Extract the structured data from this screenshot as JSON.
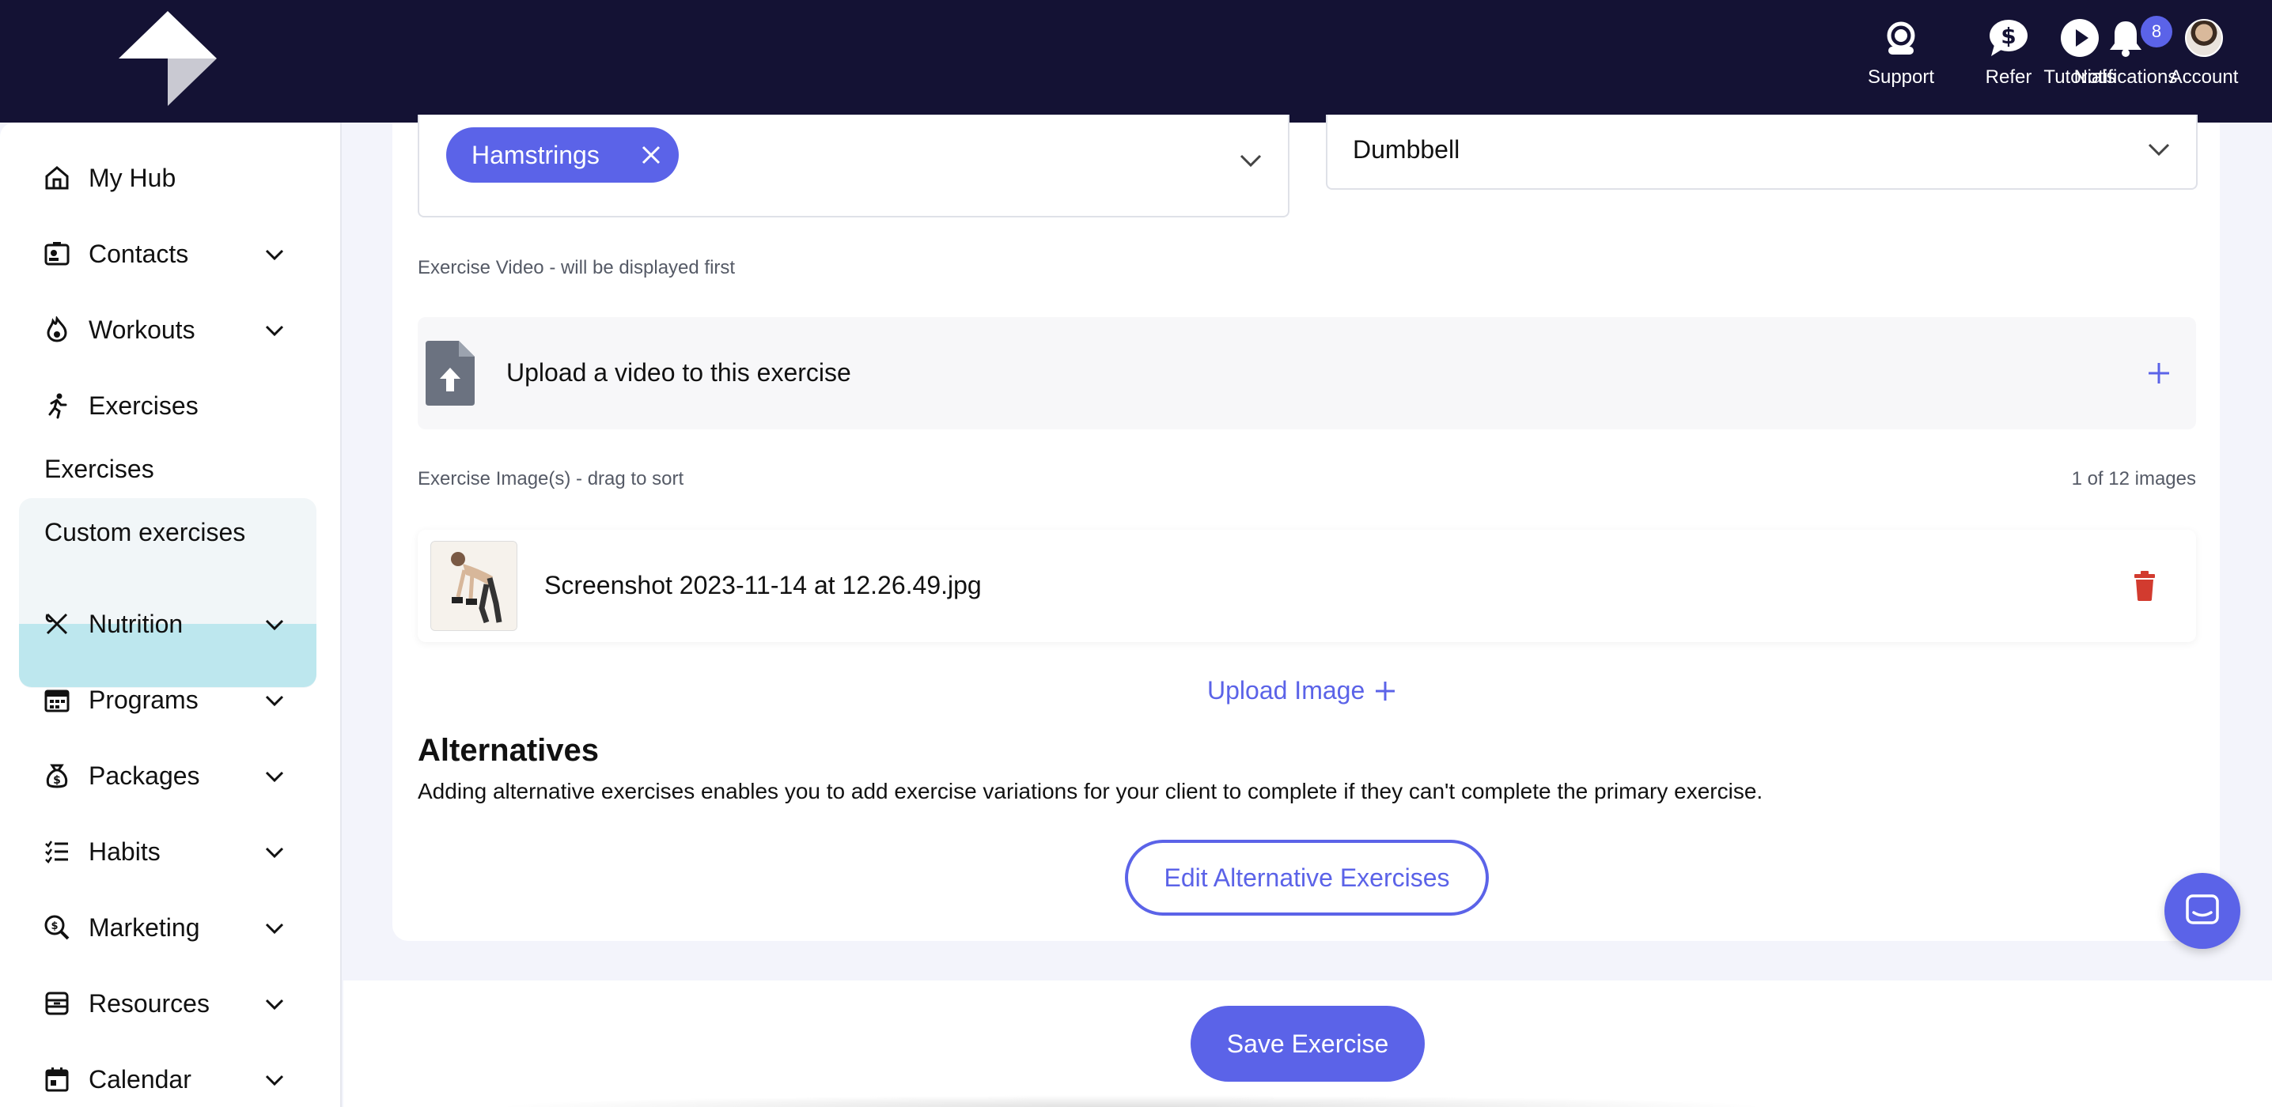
{
  "topnav": {
    "support": "Support",
    "refer": "Refer",
    "tutorials": "Tutorials",
    "notifications": "Notifications",
    "notifications_count": "8",
    "account": "Account"
  },
  "sidebar": {
    "my_hub": "My Hub",
    "contacts": "Contacts",
    "workouts": "Workouts",
    "exercises": "Exercises",
    "exercises_sub": "Exercises",
    "custom_exercises": "Custom exercises",
    "nutrition": "Nutrition",
    "programs": "Programs",
    "packages": "Packages",
    "habits": "Habits",
    "marketing": "Marketing",
    "resources": "Resources",
    "calendar": "Calendar"
  },
  "form": {
    "muscle_chip": "Hamstrings",
    "equipment_value": "Dumbbell",
    "video_label": "Exercise Video - will be displayed first",
    "upload_video_text": "Upload a video to this exercise",
    "images_label": "Exercise Image(s) - drag to sort",
    "images_count": "1 of 12 images",
    "image_filename": "Screenshot 2023-11-14 at 12.26.49.jpg",
    "upload_image": "Upload Image",
    "alternatives_title": "Alternatives",
    "alternatives_desc": "Adding alternative exercises enables you to add exercise variations for your client to complete if they can't complete the primary exercise.",
    "edit_alternatives": "Edit Alternative Exercises",
    "save_exercise": "Save Exercise"
  },
  "colors": {
    "topbar": "#141234",
    "accent": "#5b63e8",
    "active_nav": "#bde7ee",
    "delete": "#d23b2f"
  }
}
